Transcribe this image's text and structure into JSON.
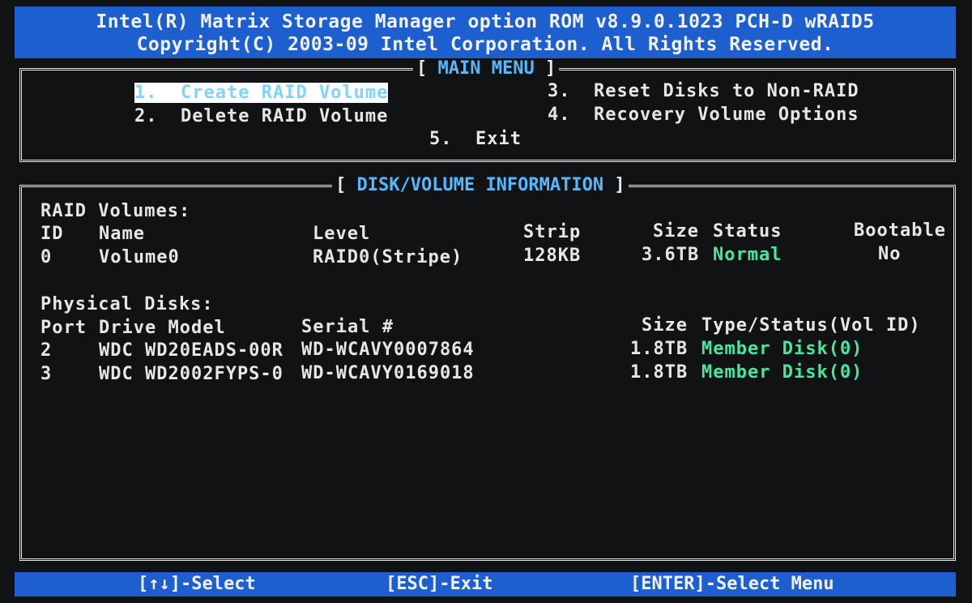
{
  "header": {
    "line1": "Intel(R) Matrix Storage Manager option ROM v8.9.0.1023 PCH-D wRAID5",
    "line2": "Copyright(C) 2003-09 Intel Corporation.  All Rights Reserved."
  },
  "main_menu": {
    "title": "MAIN MENU",
    "items": [
      {
        "num": "1.",
        "label": "Create RAID Volume"
      },
      {
        "num": "2.",
        "label": "Delete RAID Volume"
      },
      {
        "num": "3.",
        "label": "Reset Disks to Non-RAID"
      },
      {
        "num": "4.",
        "label": "Recovery Volume Options"
      },
      {
        "num": "5.",
        "label": "Exit"
      }
    ],
    "selected_index": 0
  },
  "disk_info": {
    "title": "DISK/VOLUME INFORMATION",
    "raid_volumes_heading": "RAID Volumes:",
    "raid_headers": {
      "id": "ID",
      "name": "Name",
      "level": "Level",
      "strip": "Strip",
      "size": "Size",
      "status": "Status",
      "bootable": "Bootable"
    },
    "raid_volumes": [
      {
        "id": "0",
        "name": "Volume0",
        "level": "RAID0(Stripe)",
        "strip": "128KB",
        "size": "3.6TB",
        "status": "Normal",
        "bootable": "No"
      }
    ],
    "physical_heading": "Physical Disks:",
    "disk_headers": {
      "port": "Port",
      "model": "Drive Model",
      "serial": "Serial #",
      "size": "Size",
      "type": "Type/Status(Vol ID)"
    },
    "disks": [
      {
        "port": "2",
        "model": "WDC WD20EADS-00R",
        "serial": "WD-WCAVY0007864",
        "size": "1.8TB",
        "type": "Member Disk(0)"
      },
      {
        "port": "3",
        "model": "WDC WD2002FYPS-0",
        "serial": "WD-WCAVY0169018",
        "size": "1.8TB",
        "type": "Member Disk(0)"
      }
    ]
  },
  "footer": {
    "select": "[↑↓]-Select",
    "exit": "[ESC]-Exit",
    "enter": "[ENTER]-Select Menu"
  },
  "colors": {
    "bar_blue": "#1e5fd0",
    "highlight_text": "#7fd4ff",
    "status_green": "#49e6a0",
    "background": "#101214"
  }
}
